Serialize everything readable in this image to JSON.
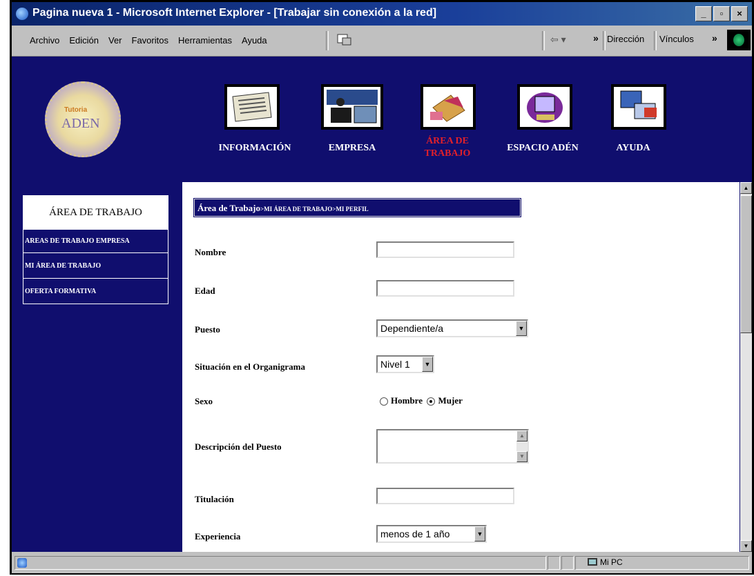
{
  "window": {
    "title": "Pagina nueva 1 - Microsoft Internet Explorer - [Trabajar sin conexión a la red]",
    "controls": [
      "_",
      "▫",
      "×"
    ]
  },
  "menubar": {
    "items": [
      "Archivo",
      "Edición",
      "Ver",
      "Favoritos",
      "Herramientas",
      "Ayuda"
    ],
    "address_label": "Dirección",
    "links_label": "Vínculos"
  },
  "logo": {
    "line1": "Tutoria",
    "line2": "ADEN"
  },
  "nav": [
    {
      "label": "INFORMACIÓN",
      "icon": "document-icon"
    },
    {
      "label": "EMPRESA",
      "icon": "office-icon"
    },
    {
      "label": "ÁREA DE TRABAJO",
      "icon": "folder-icon",
      "active": true
    },
    {
      "label": "ESPACIO ADÉN",
      "icon": "computer-icon"
    },
    {
      "label": "AYUDA",
      "icon": "help-icon"
    }
  ],
  "sidebar": {
    "title": "ÁREA DE TRABAJO",
    "items": [
      {
        "label": "AREAS DE TRABAJO EMPRESA"
      },
      {
        "label": "MI ÁREA DE TRABAJO"
      },
      {
        "label": "OFERTA FORMATIVA"
      }
    ]
  },
  "breadcrumb": {
    "root": "Área de Trabajo",
    "rest": ">MI ÁREA DE TRABAJO>MI PERFIL"
  },
  "form": {
    "nombre_label": "Nombre",
    "nombre_value": "",
    "edad_label": "Edad",
    "edad_value": "",
    "puesto_label": "Puesto",
    "puesto_value": "Dependiente/a",
    "organigrama_label": "Situación en el Organigrama",
    "organigrama_value": "Nivel 1",
    "sexo_label": "Sexo",
    "sexo_options": [
      "Hombre",
      "Mujer"
    ],
    "sexo_selected": "Mujer",
    "descripcion_label": "Descripción del Puesto",
    "titulacion_label": "Titulación",
    "experiencia_label": "Experiencia",
    "experiencia_value": "menos de 1 año"
  },
  "status": {
    "zone": "Mi PC"
  },
  "colors": {
    "page_bg": "#100e6e",
    "active_nav": "#e0202a",
    "titlebar": "#0a246a"
  }
}
